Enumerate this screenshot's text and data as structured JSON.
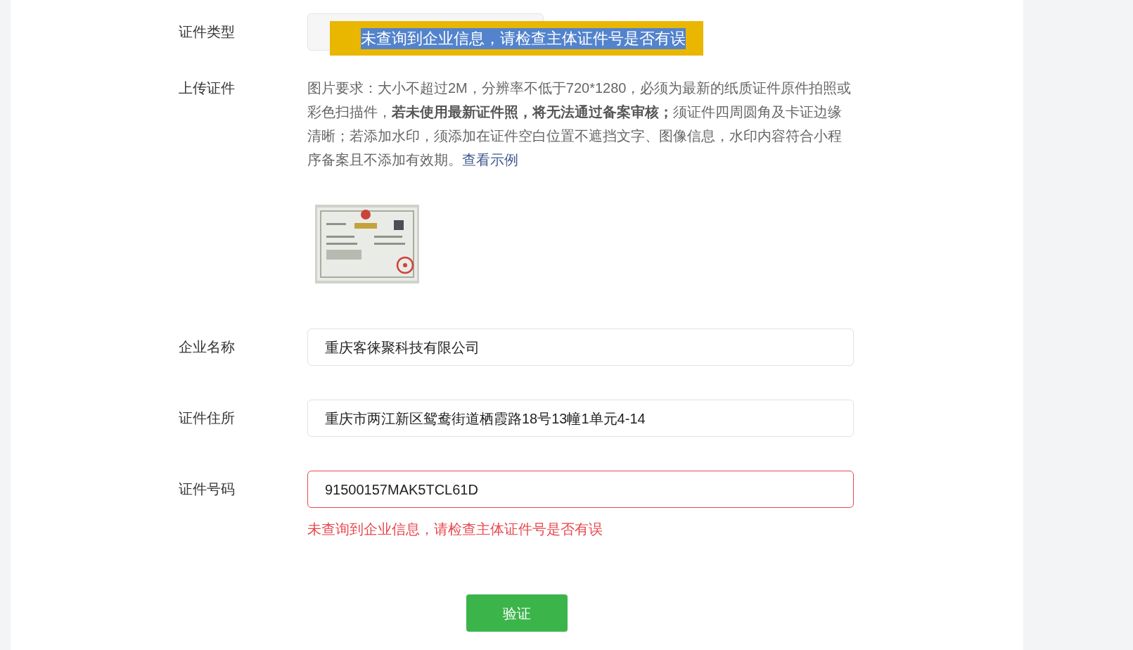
{
  "toast": {
    "message": "未查询到企业信息，请检查主体证件号是否有误",
    "text_selected": true
  },
  "form": [
    {
      "kind": "select",
      "label": "证件类型"
    },
    {
      "kind": "upload",
      "label": "上传证件",
      "description": "图片要求：大小不超过2M，分辨率不低于720*1280，必须为最新的纸质证件原件拍照或彩色扫描件，**若未使用最新证件照，将无法通过备案审核；**须证件四周圆角及卡证边缘清晰；若添加水印，须添加在证件空白位置不遮挡文字、图像信息，水印内容符合小程序备案且不添加有效期。",
      "link": "查看示例"
    },
    {
      "kind": "input",
      "label": "企业名称",
      "value": "重庆客徕聚科技有限公司",
      "error": false
    },
    {
      "kind": "input",
      "label": "证件住所",
      "value": "重庆市两江新区鸳鸯街道栖霞路18号13幢1单元4-14",
      "error": false
    },
    {
      "kind": "input",
      "label": "证件号码",
      "value": "91500157MAK5TCL61D",
      "error": true,
      "error_message": "未查询到企业信息，请检查主体证件号是否有误"
    }
  ],
  "submit": {
    "label": "验证"
  }
}
